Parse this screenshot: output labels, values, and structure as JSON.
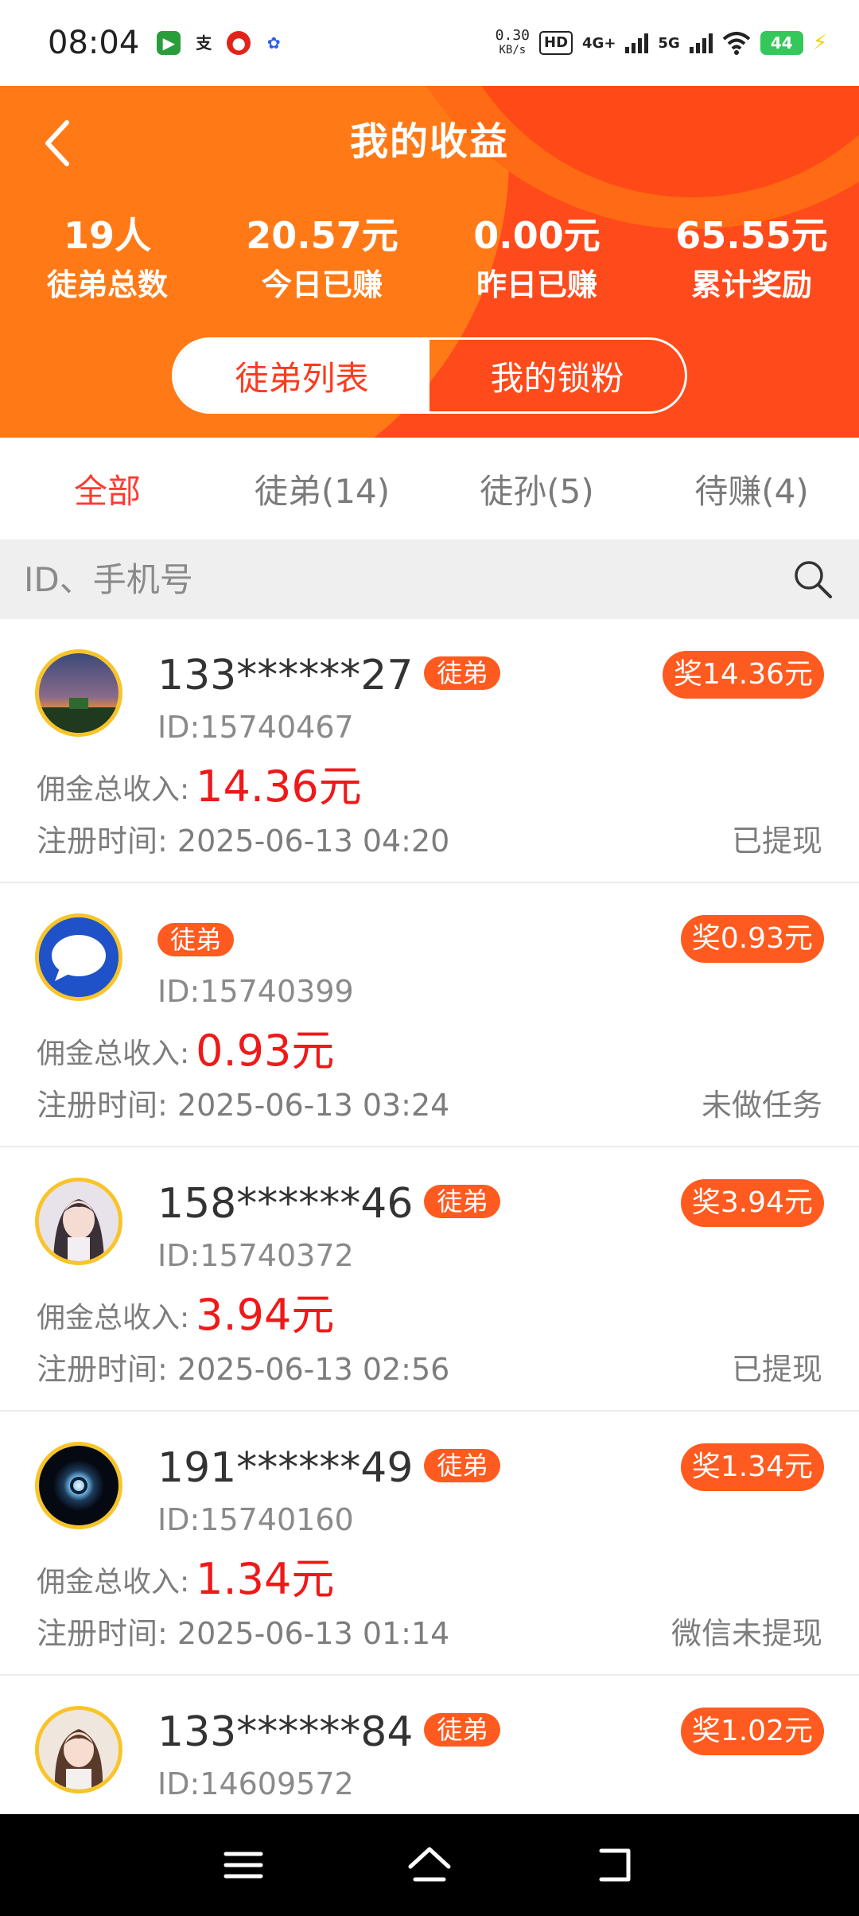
{
  "status_bar": {
    "time": "08:04",
    "net_speed_value": "0.30",
    "net_speed_unit": "KB/s",
    "hd_label": "HD",
    "net_4g": "4G+",
    "net_5g": "5G",
    "battery": "44",
    "app_icons": [
      "video-app-icon",
      "alipay-icon",
      "red-app-icon",
      "baidu-icon"
    ],
    "battery_color": "#34c759"
  },
  "header": {
    "title": "我的收益",
    "stats": [
      {
        "value": "19人",
        "label": "徒弟总数"
      },
      {
        "value": "20.57元",
        "label": "今日已赚"
      },
      {
        "value": "0.00元",
        "label": "昨日已赚"
      },
      {
        "value": "65.55元",
        "label": "累计奖励"
      }
    ],
    "segments": [
      {
        "label": "徒弟列表",
        "active": true
      },
      {
        "label": "我的锁粉",
        "active": false
      }
    ],
    "bg_color": "#ff4a1c"
  },
  "tabs": [
    {
      "label": "全部",
      "active": true
    },
    {
      "label": "徒弟(14)",
      "active": false
    },
    {
      "label": "徒孙(5)",
      "active": false
    },
    {
      "label": "待赚(4)",
      "active": false
    }
  ],
  "search": {
    "placeholder": "ID、手机号"
  },
  "list": {
    "income_label": "佣金总收入:",
    "regtime_label": "注册时间:",
    "items": [
      {
        "phone": "133******27",
        "badge": "徒弟",
        "id": "ID:15740467",
        "reward": "奖14.36元",
        "income": "14.36元",
        "regtime": "2025-06-13 04:20",
        "status": "已提现",
        "avatar": "sunset-photo"
      },
      {
        "phone": "",
        "badge": "徒弟",
        "id": "ID:15740399",
        "reward": "奖0.93元",
        "income": "0.93元",
        "regtime": "2025-06-13 03:24",
        "status": "未做任务",
        "avatar": "chat-bubble"
      },
      {
        "phone": "158******46",
        "badge": "徒弟",
        "id": "ID:15740372",
        "reward": "奖3.94元",
        "income": "3.94元",
        "regtime": "2025-06-13 02:56",
        "status": "已提现",
        "avatar": "anime-girl"
      },
      {
        "phone": "191******49",
        "badge": "徒弟",
        "id": "ID:15740160",
        "reward": "奖1.34元",
        "income": "1.34元",
        "regtime": "2025-06-13 01:14",
        "status": "微信未提现",
        "avatar": "glow-orb"
      },
      {
        "phone": "133******84",
        "badge": "徒弟",
        "id": "ID:14609572",
        "reward": "奖1.02元",
        "income": "",
        "regtime": "",
        "status": "",
        "avatar": "portrait-girl"
      }
    ]
  },
  "colors": {
    "accent_red": "#ff3b30",
    "badge_orange": "#ff5a1f",
    "income_red": "#f01818",
    "avatar_ring": "#f8c42a"
  },
  "navbar": {
    "buttons": [
      "menu-icon",
      "home-icon",
      "back-icon"
    ]
  }
}
